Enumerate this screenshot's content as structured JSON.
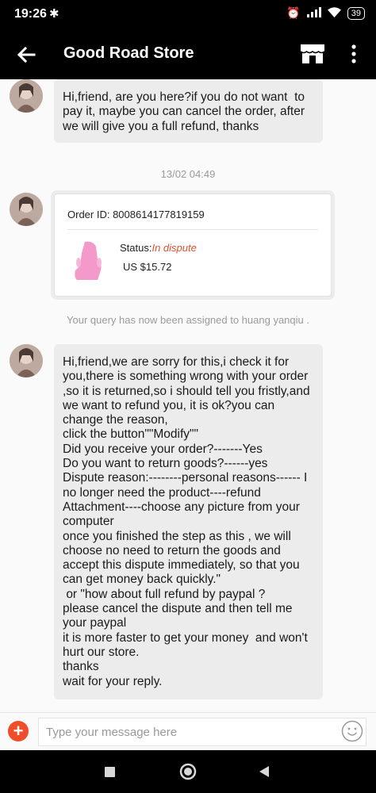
{
  "status_bar": {
    "time": "19:26",
    "battery": "39"
  },
  "header": {
    "title": "Good Road Store"
  },
  "messages": {
    "m1": "Hi,friend, are you here?if you do not want  to pay it, maybe you can cancel the order, after we will give you a full refund, thanks",
    "timestamp": "13/02 04:49",
    "order_card": {
      "order_id": "Order ID: 8008614177819159",
      "status_label": "Status:",
      "status_value": "In dispute",
      "price": "US $15.72"
    },
    "system_notice": "Your query has now been assigned to huang yanqiu .",
    "m2": "Hi,friend,we are sorry for this,i check it for you,there is something wrong with your order ,so it is returned,so i should tell you fristly,and we want to refund you, it is ok?you can change the reason,\nclick the button\"\"Modify\"\"\nDid you receive your order?-------Yes\nDo you want to return goods?------yes\nDispute reason:--------personal reasons------ I no longer need the product----refund\nAttachment----choose any picture from your computer\nonce you finished the step as this , we will choose no need to return the goods and accept this dispute immediately, so that you can get money back quickly.\"\n or \"how about full refund by paypal ?\nplease cancel the dispute and then tell me your paypal\nit is more faster to get your money  and won't hurt our store.\nthanks\nwait for your reply."
  },
  "composer": {
    "placeholder": "Type your message here"
  },
  "colors": {
    "accent": "#ef4e2b",
    "status_dispute": "#e0512b",
    "bar": "#000000",
    "bubble": "#ececec"
  },
  "icons": [
    "back-arrow-icon",
    "store-icon",
    "more-vert-icon",
    "plus-icon",
    "emoji-icon",
    "recents-icon",
    "home-icon",
    "back-triangle-icon"
  ]
}
